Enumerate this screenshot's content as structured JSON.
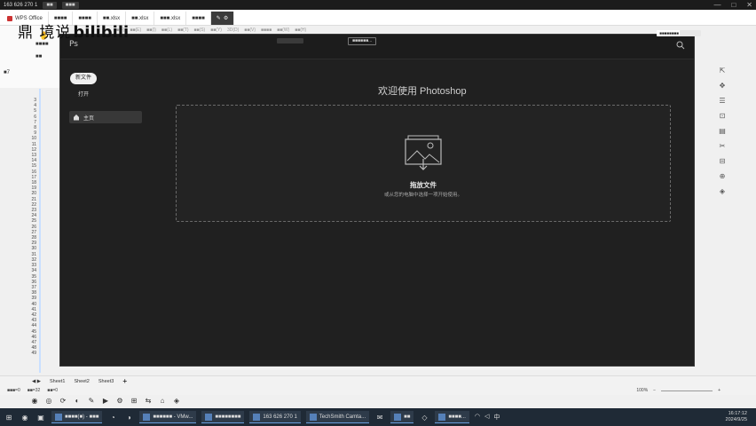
{
  "remote_bar": {
    "address": "163 626 270 1",
    "buttons": [
      "■■",
      "■■■"
    ],
    "window_controls": [
      "—",
      "□",
      "✕"
    ]
  },
  "wps": {
    "tabs": [
      {
        "label": "WPS Office"
      },
      {
        "label": "■■■■"
      },
      {
        "label": "■■■■"
      },
      {
        "label": "■■.xlsx"
      },
      {
        "label": "■■.xlsx"
      },
      {
        "label": "■■■.xlsx"
      },
      {
        "label": "■■■■"
      }
    ],
    "ribbon": {
      "tool1": "■■■■",
      "tool2": "■■",
      "cell_ref": "■7"
    },
    "row_numbers": [
      "3",
      "4",
      "5",
      "6",
      "7",
      "8",
      "9",
      "10",
      "11",
      "12",
      "13",
      "14",
      "15",
      "16",
      "17",
      "18",
      "19",
      "20",
      "21",
      "22",
      "23",
      "24",
      "25",
      "26",
      "27",
      "28",
      "29",
      "30",
      "31",
      "32",
      "33",
      "34",
      "35",
      "36",
      "37",
      "38",
      "39",
      "40",
      "41",
      "42",
      "43",
      "44",
      "45",
      "46",
      "47",
      "48",
      "49"
    ],
    "sheets": [
      "Sheet1",
      "Sheet2",
      "Sheet3"
    ],
    "add_sheet": "+",
    "status": [
      "■■■=0",
      "■■=32",
      "■■=0"
    ],
    "zoom_value": "100%"
  },
  "watermark": {
    "text": "鼎 境说",
    "brand": "bilibili"
  },
  "photoshop": {
    "logo": "Ps",
    "menu": [
      "■■(F)",
      "■■(E)",
      "■■(I)",
      "■■(L)",
      "■■(T)",
      "■■(S)",
      "■■(Y)",
      "3D(D)",
      "■■(V)",
      "■■■■",
      "■■(W)",
      "■■(H)"
    ],
    "new_features_label": "■■■■■■...",
    "new_button": "新文件",
    "open_label": "打开",
    "home_label": "主页",
    "welcome": "欢迎使用 Photoshop",
    "drop_title": "拖放文件",
    "drop_subtitle": "或从您的电脑中选择一项开始使用。",
    "cloud_label": "■■■■■■■■"
  },
  "taskbar": {
    "apps": [
      {
        "label": "■■■■(■) - ■■■"
      },
      {
        "label": "■■■■■■ - VMw..."
      },
      {
        "label": "■■■■■■■■"
      },
      {
        "label": "163 626 270 1"
      },
      {
        "label": "TechSmith Camta..."
      },
      {
        "label": "■■"
      },
      {
        "label": "■■■■..."
      }
    ],
    "time": "16:17:12",
    "date": "2024/9/25",
    "time2": "16:17",
    "date2": "2024/9/25"
  }
}
